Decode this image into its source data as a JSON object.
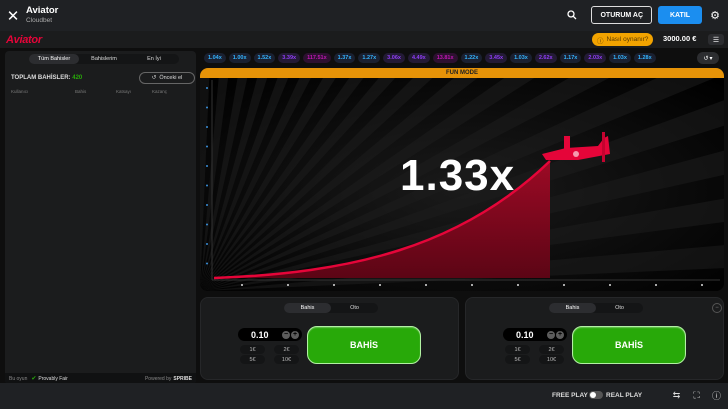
{
  "header": {
    "close_icon": "✕",
    "title": "Aviator",
    "subtitle": "Cloudbet",
    "login_label": "OTURUM AÇ",
    "join_label": "KATIL"
  },
  "game_bar": {
    "logo": "Aviator",
    "how_to_play": "Nasıl oynanır?",
    "balance": "3000.00 €"
  },
  "bets_panel": {
    "tabs": [
      {
        "label": "Tüm Bahisler",
        "active": true
      },
      {
        "label": "Bahislerim",
        "active": false
      },
      {
        "label": "En İyi",
        "active": false
      }
    ],
    "total_bets_label": "TOPLAM BAHİSLER:",
    "total_bets_count": "420",
    "previous_hand_label": "Önceki el",
    "columns": [
      "Kullanıcı",
      "Bahis",
      "Katsayı",
      "Kazanç"
    ],
    "footer_prefix": "Bu oyun",
    "provably_fair": "Provably Fair",
    "powered_by": "Powered by",
    "provider": "SPRIBE"
  },
  "multiplier_history": [
    {
      "value": "1.04x",
      "color": "#34b4ff"
    },
    {
      "value": "1.00x",
      "color": "#34b4ff"
    },
    {
      "value": "1.52x",
      "color": "#34b4ff"
    },
    {
      "value": "3.39x",
      "color": "#913ef8"
    },
    {
      "value": "117.51x",
      "color": "#c017b4"
    },
    {
      "value": "1.37x",
      "color": "#34b4ff"
    },
    {
      "value": "1.27x",
      "color": "#34b4ff"
    },
    {
      "value": "3.06x",
      "color": "#913ef8"
    },
    {
      "value": "4.49x",
      "color": "#913ef8"
    },
    {
      "value": "13.81x",
      "color": "#c017b4"
    },
    {
      "value": "1.22x",
      "color": "#34b4ff"
    },
    {
      "value": "3.45x",
      "color": "#913ef8"
    },
    {
      "value": "1.03x",
      "color": "#34b4ff"
    },
    {
      "value": "2.62x",
      "color": "#913ef8"
    },
    {
      "value": "1.17x",
      "color": "#34b4ff"
    },
    {
      "value": "2.03x",
      "color": "#913ef8"
    },
    {
      "value": "1.03x",
      "color": "#34b4ff"
    },
    {
      "value": "1.28x",
      "color": "#34b4ff"
    }
  ],
  "stage": {
    "fun_mode_label": "FUN MODE",
    "current_multiplier": "1.33x",
    "accent_color": "#e50539"
  },
  "bet_panels": [
    {
      "tabs": [
        {
          "label": "Bahis",
          "active": true
        },
        {
          "label": "Oto",
          "active": false
        }
      ],
      "stake": "0.10",
      "quick_amounts": [
        "1€",
        "2€",
        "5€",
        "10€"
      ],
      "bet_label": "BAHİS"
    },
    {
      "tabs": [
        {
          "label": "Bahis",
          "active": true
        },
        {
          "label": "Oto",
          "active": false
        }
      ],
      "stake": "0.10",
      "quick_amounts": [
        "1€",
        "2€",
        "5€",
        "10€"
      ],
      "bet_label": "BAHİS"
    }
  ],
  "footer": {
    "free_play": "FREE PLAY",
    "real_play": "REAL PLAY"
  },
  "colors": {
    "bet_green": "#28a909",
    "join_blue": "#1b8ef0",
    "fun_mode_orange": "#e69308"
  }
}
